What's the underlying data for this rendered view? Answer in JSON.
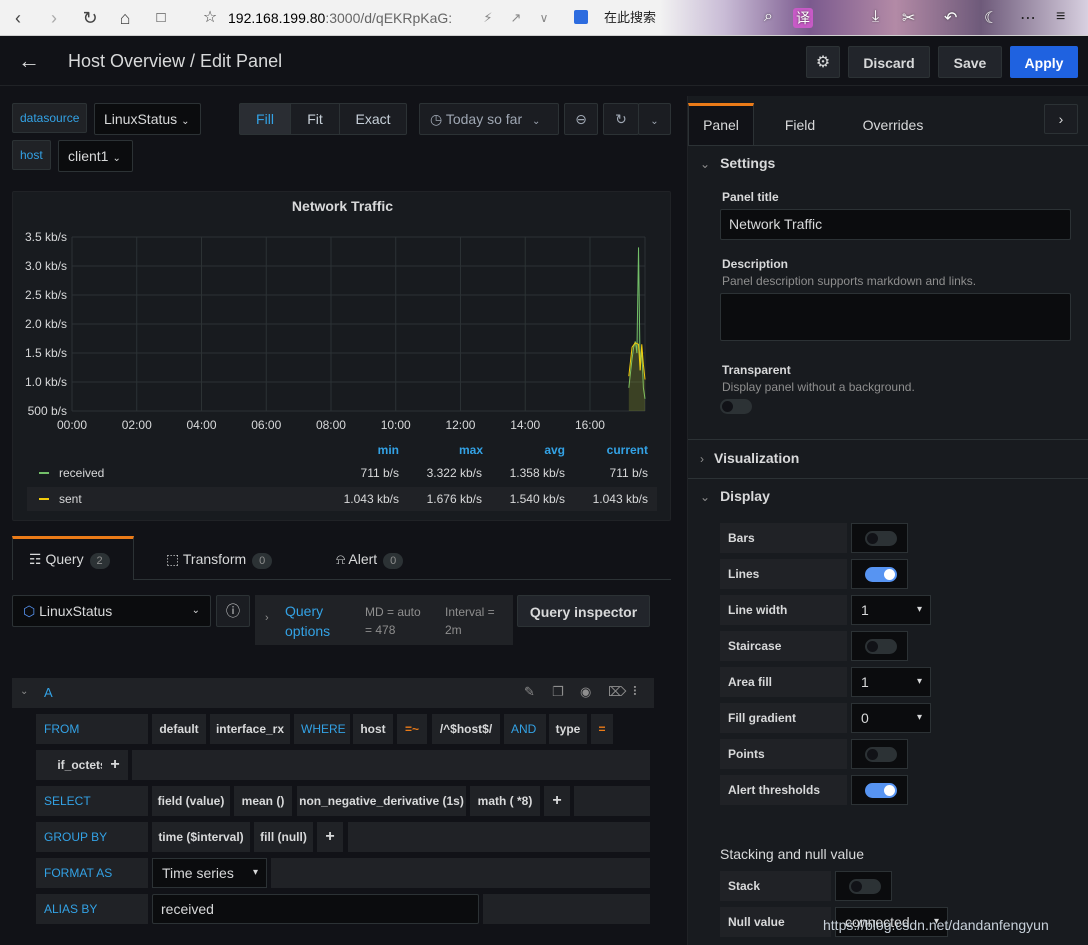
{
  "browser": {
    "url_host": "192.168.199.80",
    "url_rest": ":3000/d/qEKRpKaG:",
    "search_engine": "在此搜索",
    "translate_icon_text": "译"
  },
  "header": {
    "title": "Host Overview / Edit Panel",
    "discard": "Discard",
    "save": "Save",
    "apply": "Apply"
  },
  "variables": [
    {
      "label": "datasource",
      "value": "LinuxStatus"
    },
    {
      "label": "host",
      "value": "client1"
    }
  ],
  "view_modes": [
    "Fill",
    "Fit",
    "Exact"
  ],
  "time_range": "Today so far",
  "chart_data": {
    "type": "line",
    "title": "Network Traffic",
    "x": [
      "00:00",
      "02:00",
      "04:00",
      "06:00",
      "08:00",
      "10:00",
      "12:00",
      "14:00",
      "16:00"
    ],
    "yticks": [
      "500 b/s",
      "1.0 kb/s",
      "1.5 kb/s",
      "2.0 kb/s",
      "2.5 kb/s",
      "3.0 kb/s",
      "3.5 kb/s"
    ],
    "ylim": [
      500,
      3500
    ],
    "xlim_hours": [
      0,
      17.7
    ],
    "grid": true,
    "series": [
      {
        "name": "received",
        "color": "#73bf69",
        "min": "711 b/s",
        "max": "3.322 kb/s",
        "avg": "1.358 kb/s",
        "current": "711 b/s",
        "points": [
          [
            17.2,
            900
          ],
          [
            17.3,
            1400
          ],
          [
            17.35,
            1600
          ],
          [
            17.4,
            1700
          ],
          [
            17.45,
            1500
          ],
          [
            17.5,
            3322
          ],
          [
            17.55,
            1200
          ],
          [
            17.6,
            1600
          ],
          [
            17.65,
            900
          ],
          [
            17.7,
            711
          ]
        ]
      },
      {
        "name": "sent",
        "color": "#f2cc0c",
        "min": "1.043 kb/s",
        "max": "1.676 kb/s",
        "avg": "1.540 kb/s",
        "current": "1.043 kb/s",
        "points": [
          [
            17.2,
            1100
          ],
          [
            17.3,
            1600
          ],
          [
            17.4,
            1676
          ],
          [
            17.5,
            1650
          ],
          [
            17.55,
            1200
          ],
          [
            17.6,
            1650
          ],
          [
            17.65,
            1300
          ],
          [
            17.7,
            1043
          ]
        ]
      }
    ],
    "legend_columns": [
      "min",
      "max",
      "avg",
      "current"
    ]
  },
  "tabs": [
    {
      "label": "Query",
      "count": "2"
    },
    {
      "label": "Transform",
      "count": "0"
    },
    {
      "label": "Alert",
      "count": "0"
    }
  ],
  "query": {
    "datasource": "LinuxStatus",
    "options_label": "Query options",
    "md": "MD = auto = 478",
    "interval": "Interval = 2m",
    "inspector": "Query inspector",
    "ref_id": "A",
    "from": {
      "kw": "FROM",
      "tokens": [
        "default",
        "interface_rx",
        "WHERE",
        "host",
        "=~",
        "/^$host$/",
        "AND",
        "type",
        "="
      ]
    },
    "from_row2": [
      "if_octets",
      "+"
    ],
    "select": {
      "kw": "SELECT",
      "tokens": [
        "field (value)",
        "mean ()",
        "non_negative_derivative (1s)",
        "math ( *8)",
        "+"
      ]
    },
    "group_by": {
      "kw": "GROUP BY",
      "tokens": [
        "time ($interval)",
        "fill (null)",
        "+"
      ]
    },
    "format_as": {
      "kw": "FORMAT AS",
      "value": "Time series"
    },
    "alias_by": {
      "kw": "ALIAS BY",
      "value": "received"
    }
  },
  "right_panel": {
    "tabs": [
      "Panel",
      "Field",
      "Overrides"
    ],
    "settings": "Settings",
    "panel_title_label": "Panel title",
    "panel_title_value": "Network Traffic",
    "description_label": "Description",
    "description_help": "Panel description supports markdown and links.",
    "transparent_label": "Transparent",
    "transparent_help": "Display panel without a background.",
    "visualization": "Visualization",
    "display": "Display",
    "display_options": [
      {
        "label": "Bars",
        "type": "switch",
        "on": false
      },
      {
        "label": "Lines",
        "type": "switch",
        "on": true
      },
      {
        "label": "Line width",
        "type": "select",
        "value": "1"
      },
      {
        "label": "Staircase",
        "type": "switch",
        "on": false
      },
      {
        "label": "Area fill",
        "type": "select",
        "value": "1"
      },
      {
        "label": "Fill gradient",
        "type": "select",
        "value": "0"
      },
      {
        "label": "Points",
        "type": "switch",
        "on": false
      },
      {
        "label": "Alert thresholds",
        "type": "switch",
        "on": true
      }
    ],
    "stacking_header": "Stacking and null value",
    "stack_label": "Stack",
    "null_value_label": "Null value",
    "null_value": "connected"
  },
  "watermark": "https://blog.csdn.net/dandanfengyun"
}
